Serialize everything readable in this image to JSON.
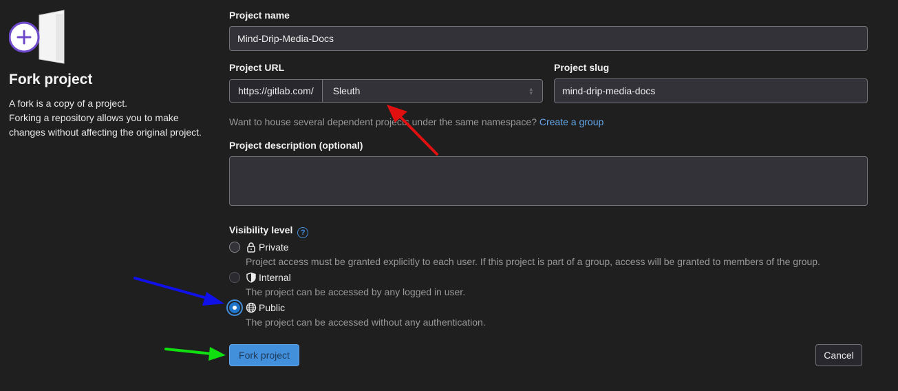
{
  "sidebar": {
    "title": "Fork project",
    "desc_line1": "A fork is a copy of a project.",
    "desc_line2": "Forking a repository allows you to make changes without affecting the original project."
  },
  "form": {
    "project_name_label": "Project name",
    "project_name_value": "Mind-Drip-Media-Docs",
    "project_url_label": "Project URL",
    "url_prefix": "https://gitlab.com/",
    "namespace_value": "Sleuth",
    "project_slug_label": "Project slug",
    "project_slug_value": "mind-drip-media-docs",
    "namespace_help": "Want to house several dependent projects under the same namespace?",
    "create_group_link": "Create a group",
    "description_label": "Project description (optional)",
    "visibility_label": "Visibility level",
    "visibility_help_icon": "?",
    "options": [
      {
        "label": "Private",
        "desc": "Project access must be granted explicitly to each user. If this project is part of a group, access will be granted to members of the group.",
        "icon": "lock-icon",
        "state": "unchecked"
      },
      {
        "label": "Internal",
        "desc": "The project can be accessed by any logged in user.",
        "icon": "shield-icon",
        "state": "disabled"
      },
      {
        "label": "Public",
        "desc": "The project can be accessed without any authentication.",
        "icon": "globe-icon",
        "state": "checked"
      }
    ],
    "fork_button": "Fork project",
    "cancel_button": "Cancel"
  },
  "annotations": {
    "red_arrow_color": "#e01010",
    "blue_arrow_color": "#1010e8",
    "green_arrow_color": "#10e010"
  },
  "colors": {
    "background": "#1f1f1f",
    "primary": "#428fdc",
    "link": "#63a6e9",
    "illustration_accent": "#6e49cb"
  }
}
